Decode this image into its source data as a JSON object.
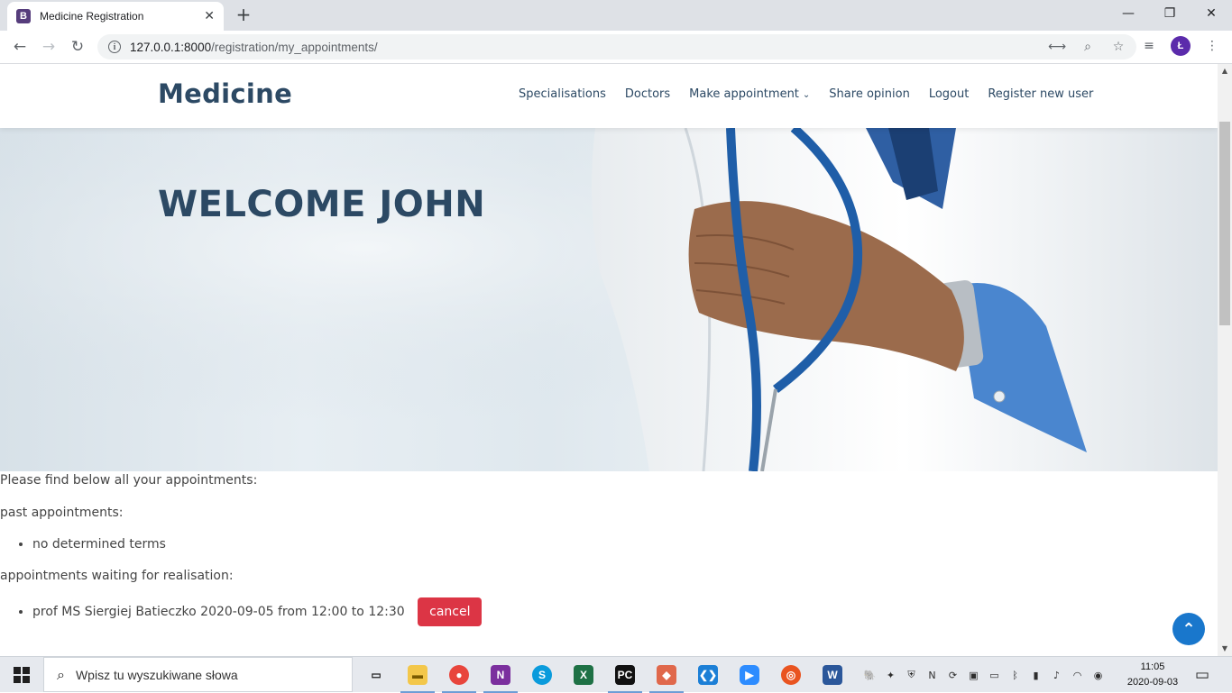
{
  "browser": {
    "tab_title": "Medicine Registration",
    "tab_favicon_letter": "B",
    "url_host": "127.0.0.1:8000",
    "url_path": "/registration/my_appointments/",
    "profile_initial": "Ł"
  },
  "site": {
    "brand": "Medicine",
    "nav": {
      "specialisations": "Specialisations",
      "doctors": "Doctors",
      "make_appointment": "Make appointment",
      "share_opinion": "Share opinion",
      "logout": "Logout",
      "register_new_user": "Register new user"
    },
    "hero_title": "WELCOME JOHN"
  },
  "appointments": {
    "intro": "Please find below all your appointments:",
    "past_heading": "past appointments:",
    "past_items": [
      "no determined terms"
    ],
    "waiting_heading": "appointments waiting for realisation:",
    "waiting_items": [
      {
        "text": "prof MS Siergiej Batieczko 2020-09-05 from 12:00 to 12:30",
        "action": "cancel"
      }
    ]
  },
  "taskbar": {
    "search_placeholder": "Wpisz tu wyszukiwane słowa",
    "time": "11:05",
    "date": "2020-09-03"
  },
  "colors": {
    "brand": "#2c4964",
    "accent": "#1977cc",
    "cancel": "#dc3545"
  }
}
